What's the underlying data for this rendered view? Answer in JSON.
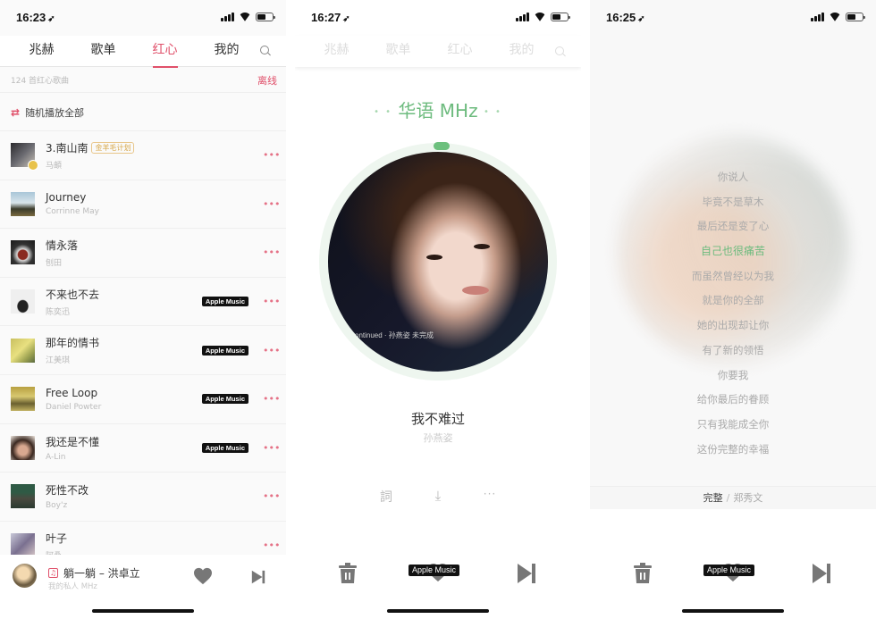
{
  "colors": {
    "accent_red": "#e0506a",
    "accent_green": "#6dbb7e",
    "gold": "#d8a84a",
    "apple_badge_bg": "#111111"
  },
  "screens": [
    {
      "status": {
        "time": "16:23",
        "location_icon": "location-arrow-icon"
      },
      "tabs": [
        {
          "label": "兆赫",
          "active": false
        },
        {
          "label": "歌单",
          "active": false
        },
        {
          "label": "红心",
          "active": true
        },
        {
          "label": "我的",
          "active": false
        }
      ],
      "search_icon": "search-icon",
      "subheader": {
        "count_text": "124 首红心歌曲",
        "offline_label": "离线"
      },
      "shuffle": {
        "icon": "shuffle-icon",
        "label": "随机播放全部"
      },
      "songs": [
        {
          "title": "3.南山南",
          "artist": "马頔",
          "tag": "金羊毛计划",
          "apple_music": false
        },
        {
          "title": "Journey",
          "artist": "Corrinne May",
          "tag": null,
          "apple_music": false
        },
        {
          "title": "情永落",
          "artist": "刨田",
          "tag": null,
          "apple_music": false
        },
        {
          "title": "不来也不去",
          "artist": "陈奕迅",
          "tag": null,
          "apple_music": true
        },
        {
          "title": "那年的情书",
          "artist": "江美琪",
          "tag": null,
          "apple_music": true
        },
        {
          "title": "Free Loop",
          "artist": "Daniel Powter",
          "tag": null,
          "apple_music": true
        },
        {
          "title": "我还是不懂",
          "artist": "A-Lin",
          "tag": null,
          "apple_music": true
        },
        {
          "title": "死性不改",
          "artist": "Boy'z",
          "tag": null,
          "apple_music": false
        },
        {
          "title": "叶子",
          "artist": "阿桑",
          "tag": null,
          "apple_music": false
        }
      ],
      "apple_music_label": "Apple Music",
      "more_label": "•••",
      "mini_player": {
        "title": "躺一躺 – 洪卓立",
        "subtitle": "我的私人 MHz",
        "note_icon": "♫"
      }
    },
    {
      "status": {
        "time": "16:27"
      },
      "tabs": [
        {
          "label": "兆赫"
        },
        {
          "label": "歌单"
        },
        {
          "label": "红心"
        },
        {
          "label": "我的"
        }
      ],
      "channel": {
        "name": "华语 MHz",
        "dots_left": "• •",
        "dots_right": "• •"
      },
      "album_caption": "ontinued · 孙燕姿 未完成",
      "progress": 0.01,
      "now_playing": {
        "title": "我不难过",
        "artist": "孙燕姿"
      },
      "actions": {
        "lyrics_label": "詞",
        "download_label": "⤓",
        "more_label": "···"
      },
      "apple_music_label": "Apple Music"
    },
    {
      "status": {
        "time": "16:25"
      },
      "lyrics": [
        {
          "text": "你说人",
          "current": false
        },
        {
          "text": "毕竟不是草木",
          "current": false
        },
        {
          "text": "最后还是变了心",
          "current": false
        },
        {
          "text": "自己也很痛苦",
          "current": true
        },
        {
          "text": "而虽然曾经以为我",
          "current": false
        },
        {
          "text": "就是你的全部",
          "current": false
        },
        {
          "text": "她的出现却让你",
          "current": false
        },
        {
          "text": "有了新的领悟",
          "current": false
        },
        {
          "text": "你要我",
          "current": false
        },
        {
          "text": "给你最后的眷顾",
          "current": false
        },
        {
          "text": "只有我能成全你",
          "current": false
        },
        {
          "text": "这份完整的幸福",
          "current": false
        }
      ],
      "footer": {
        "song": "完整",
        "separator": "/",
        "artist": "郑秀文"
      },
      "apple_music_label": "Apple Music"
    }
  ]
}
